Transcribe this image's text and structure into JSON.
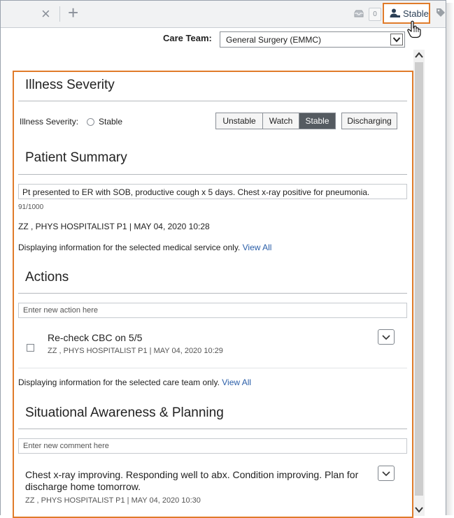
{
  "tabbar": {
    "close_glyph": "×",
    "add_glyph": "+",
    "inbox_count": "0",
    "status_label": "Stable"
  },
  "care_team": {
    "label": "Care Team:",
    "selected": "General Surgery (EMMC)"
  },
  "illness_severity": {
    "title": "Illness Severity",
    "field_label": "Illness Severity:",
    "current": "Stable",
    "options": [
      "Unstable",
      "Watch",
      "Stable",
      "Discharging"
    ],
    "selected_option": "Stable"
  },
  "patient_summary": {
    "title": "Patient Summary",
    "text": "Pt presented to ER with SOB, productive cough x 5 days. Chest x-ray positive for pneumonia.",
    "char_count": "91/1000",
    "author_line": "ZZ , PHYS HOSPITALIST P1 | MAY 04, 2020 10:28",
    "note": "Displaying information for the selected medical service only.",
    "view_all": "View All"
  },
  "actions": {
    "title": "Actions",
    "placeholder": "Enter new action here",
    "items": [
      {
        "text": "Re-check CBC on 5/5",
        "author_line": "ZZ , PHYS HOSPITALIST P1 | MAY 04, 2020 10:29"
      }
    ],
    "note": "Displaying information for the selected care team only.",
    "view_all": "View All"
  },
  "situational": {
    "title": "Situational Awareness & Planning",
    "placeholder": "Enter new comment here",
    "items": [
      {
        "text_line1": "Chest x-ray improving. Responding well to abx. Condition improving. Plan for",
        "text_line2": "discharge home tomorrow.",
        "author_line": "ZZ , PHYS HOSPITALIST P1 | MAY 04, 2020 10:30"
      }
    ]
  },
  "colors": {
    "highlight": "#e07b2a",
    "link": "#2a5ea8",
    "active_segment": "#555b61"
  },
  "icons": [
    "close-icon",
    "add-icon",
    "inbox-icon",
    "person-icon",
    "tag-icon",
    "hand-cursor-icon",
    "chevron-down-icon"
  ]
}
